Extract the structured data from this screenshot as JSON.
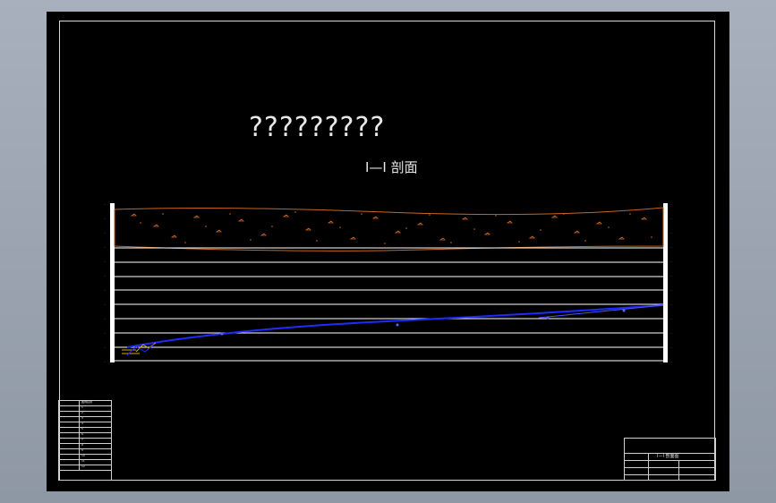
{
  "drawing": {
    "title": "?????????",
    "section_label": "I—I 剖面"
  },
  "colors": {
    "background": "#000000",
    "frame": "#d8d8d8",
    "soil_fill": "#c8641e",
    "layer_lines": "#ffffff",
    "water_line": "#1f2bff",
    "marker": "#e0a020"
  },
  "legend": {
    "header": [
      "序号",
      "图例名称"
    ],
    "rows": [
      "1",
      "2",
      "3",
      "4",
      "5",
      "6",
      "7",
      "8",
      "9",
      "10",
      "11",
      "12"
    ]
  },
  "title_block": {
    "drawing_name": "I—I 剖面图"
  }
}
